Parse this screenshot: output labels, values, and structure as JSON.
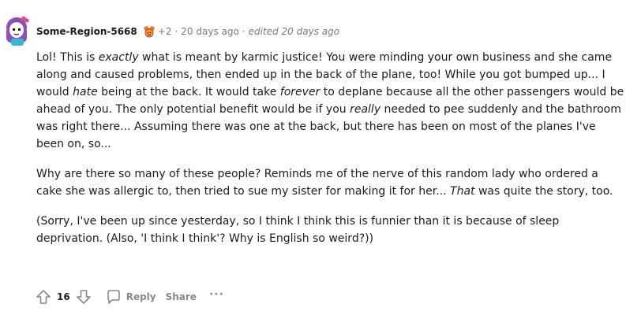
{
  "comment": {
    "author": "Some-Region-5668",
    "award_icon": "award-badge-icon",
    "award_count": "+2",
    "separator": "·",
    "age": "20 days ago",
    "edited": "edited 20 days ago",
    "paragraphs": [
      [
        {
          "t": "Lol! This is "
        },
        {
          "t": "exactly",
          "i": true
        },
        {
          "t": " what is meant by karmic justice! You were minding your own business and she came along and caused problems, then ended up in the back of the plane, too! While you got bumped up... I would "
        },
        {
          "t": "hate",
          "i": true
        },
        {
          "t": " being at the back. It would take "
        },
        {
          "t": "forever",
          "i": true
        },
        {
          "t": " to deplane because all the other passengers would be ahead of you. The only potential benefit would be if you "
        },
        {
          "t": "really",
          "i": true
        },
        {
          "t": " needed to pee suddenly and the bathroom was right there... Assuming there was one at the back, but there has been on most of the planes I've been on, so..."
        }
      ],
      [
        {
          "t": "Why are there so many of these people? Reminds me of the nerve of this random lady who ordered a cake she was allergic to, then tried to sue my sister for making it for her... "
        },
        {
          "t": "That",
          "i": true
        },
        {
          "t": " was quite the story, too."
        }
      ],
      [
        {
          "t": "(Sorry, I've been up since yesterday, so I think I think this is funnier than it is because of sleep deprivation. (Also, 'I think I think'? Why is English so weird?))"
        }
      ]
    ]
  },
  "actions": {
    "score": "16",
    "reply_label": "Reply",
    "share_label": "Share",
    "more_label": "···"
  },
  "colors": {
    "meta_gray": "#7c7c7c",
    "action_gray": "#878a8c",
    "text": "#1c1c1c"
  }
}
